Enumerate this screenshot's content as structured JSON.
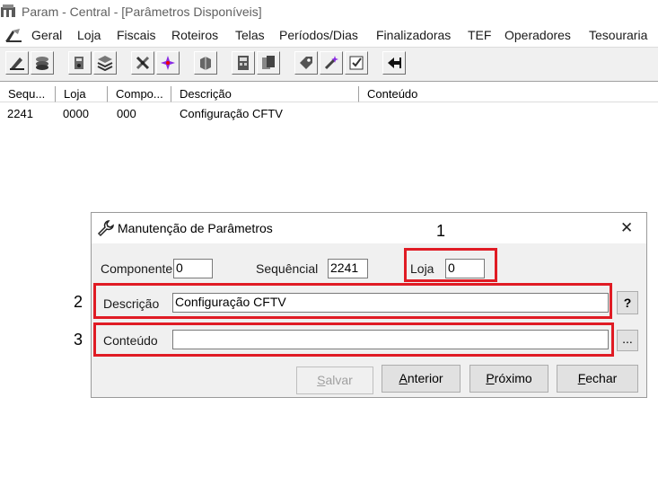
{
  "window": {
    "title": "Param - Central - [Parâmetros Disponíveis]"
  },
  "menu": [
    "Geral",
    "Loja",
    "Fiscais",
    "Roteiros",
    "Telas",
    "Períodos/Dias",
    "Finalizadoras",
    "TEF",
    "Operadores",
    "Tesouraria"
  ],
  "list": {
    "columns": [
      "Sequ...",
      "Loja",
      "Compo...",
      "Descrição",
      "Conteúdo"
    ],
    "rows": [
      {
        "seq": "2241",
        "loja": "0000",
        "comp": "000",
        "desc": "Configuração CFTV",
        "conteudo": ""
      }
    ]
  },
  "dialog": {
    "title": "Manutenção de Parâmetros",
    "close": "✕",
    "componente_label": "Componente",
    "componente_value": "0",
    "sequencial_label": "Sequêncial",
    "sequencial_value": "2241",
    "loja_label": "Loja",
    "loja_value": "0",
    "descricao_label": "Descrição",
    "descricao_value": "Configuração CFTV",
    "help_label": "?",
    "conteudo_label": "Conteúdo",
    "conteudo_value": "",
    "browse_label": "...",
    "buttons": {
      "salvar": {
        "first": "S",
        "rest": "alvar"
      },
      "anterior": {
        "first": "A",
        "rest": "nterior"
      },
      "proximo": {
        "first": "P",
        "rest": "róximo"
      },
      "fechar": {
        "first": "F",
        "rest": "echar"
      }
    }
  },
  "annotations": [
    "1",
    "2",
    "3"
  ],
  "colors": {
    "highlight": "#e01b24",
    "dialog_bg": "#f0f0f0"
  }
}
